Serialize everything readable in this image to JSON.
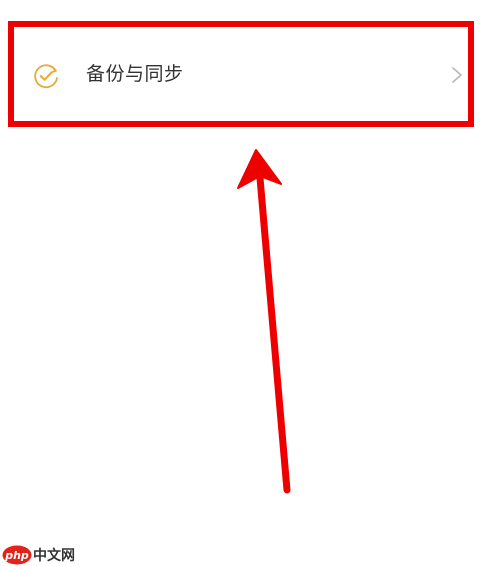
{
  "settings": {
    "backup_sync_label": "备份与同步",
    "icon": "sync-check-icon",
    "chevron_icon": "chevron-right-icon"
  },
  "annotation": {
    "highlight_color": "#ee0000",
    "arrow_color": "#ee0000"
  },
  "colors": {
    "icon_accent": "#e8a93a",
    "label_text": "#333333",
    "chevron": "#bbbbbb"
  },
  "watermark": {
    "logo_text": "php",
    "site_text": "中文网"
  }
}
